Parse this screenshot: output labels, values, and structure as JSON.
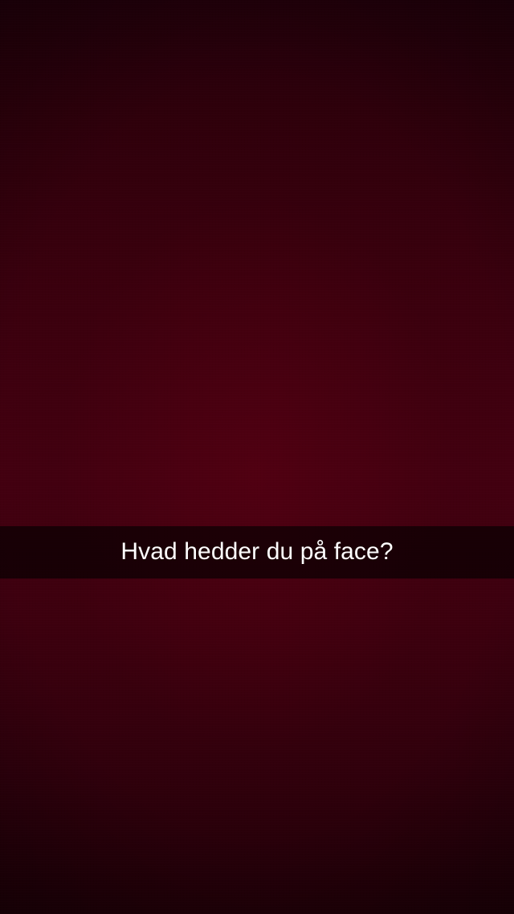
{
  "caption": {
    "text": "Hvad hedder du på face?"
  },
  "colors": {
    "background_top": "#20000a",
    "background_center": "#440011",
    "background_bottom": "#1c0007",
    "caption_bar": "rgba(0,0,0,0.62)",
    "caption_text": "#ffffff"
  }
}
